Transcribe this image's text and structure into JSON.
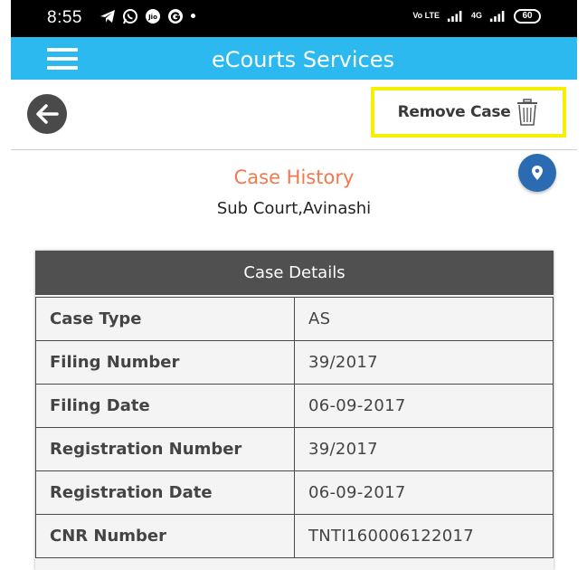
{
  "status_bar": {
    "time": "8:55",
    "network_label_1": "Vo LTE",
    "network_label_2": "4G",
    "battery": "60"
  },
  "app_bar": {
    "title": "eCourts Services"
  },
  "toolbar": {
    "remove_case_label": "Remove Case"
  },
  "case": {
    "title": "Case History",
    "court": "Sub Court,Avinashi"
  },
  "details": {
    "header": "Case Details",
    "rows": [
      {
        "label": "Case Type",
        "value": "AS"
      },
      {
        "label": "Filing Number",
        "value": "39/2017"
      },
      {
        "label": "Filing Date",
        "value": "06-09-2017"
      },
      {
        "label": "Registration Number",
        "value": "39/2017"
      },
      {
        "label": "Registration Date",
        "value": "06-09-2017"
      },
      {
        "label": "CNR Number",
        "value": "TNTI160006122017"
      }
    ]
  },
  "colors": {
    "app_bar": "#2bb9f0",
    "highlight": "#f5f000",
    "case_history": "#f07a4c",
    "location_button": "#2a6bb2",
    "card_header": "#505050"
  },
  "icons": {
    "menu": "hamburger-menu-icon",
    "back": "arrow-left-icon",
    "remove": "trash-icon",
    "location": "map-pin-icon"
  }
}
